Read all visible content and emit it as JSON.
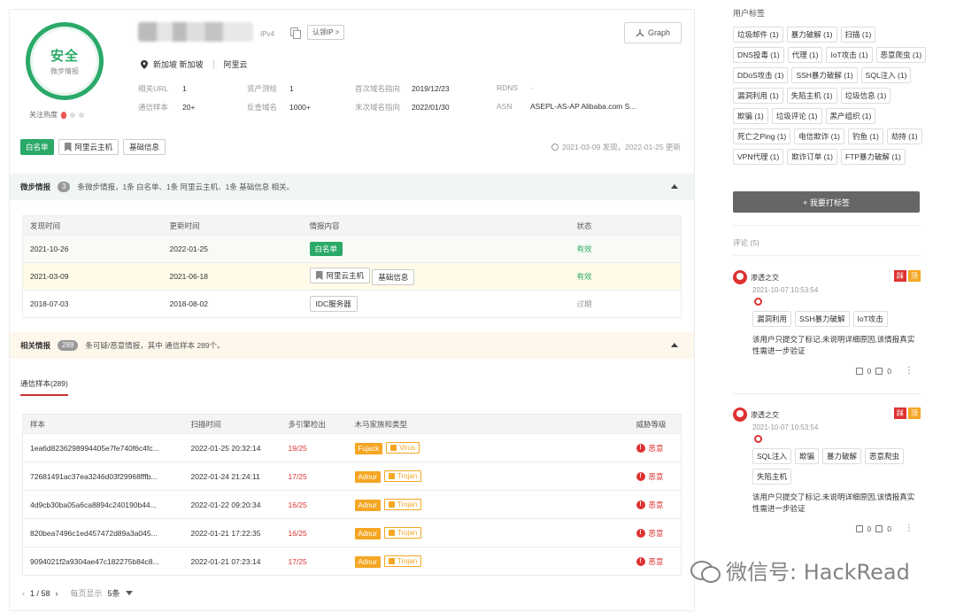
{
  "header": {
    "verdict": "安全",
    "verdict_source": "微步情报",
    "ip_type": "IPv4",
    "claim_label": "认领IP >",
    "graph_label": "Graph",
    "heat_label": "关注热度",
    "location": "新加坡 新加坡",
    "isp": "阿里云",
    "related_url_label": "相关URL",
    "related_url": "1",
    "asset_label": "资产测绘",
    "asset": "1",
    "first_domain_label": "首次域名指向",
    "first_domain": "2019/12/23",
    "rdns_label": "RDNS",
    "rdns": "-",
    "comm_label": "通信样本",
    "comm": "20+",
    "reverse_label": "反查域名",
    "reverse": "1000+",
    "last_domain_label": "末次域名指向",
    "last_domain": "2022/01/30",
    "asn_label": "ASN",
    "asn": "ASEPL-AS-AP Alibaba.com S..."
  },
  "tags": {
    "whitelist": "白名单",
    "aliyun_host": "阿里云主机",
    "basic_info": "基础信息",
    "discovered": "2021-03-09 发现，2022-01-25 更新"
  },
  "intel": {
    "title": "微步情报",
    "count": "3",
    "desc": "条微步情报，1条 白名单、1条 阿里云主机、1条 基础信息 相关。",
    "columns": [
      "发现时间",
      "更新时间",
      "情报内容",
      "状态"
    ],
    "rows": [
      {
        "found": "2021-10-26",
        "updated": "2022-01-25",
        "content": "白名单",
        "status": "有效"
      },
      {
        "found": "2021-03-09",
        "updated": "2021-06-18",
        "content": "阿里云主机",
        "content2": "基础信息",
        "status": "有效"
      },
      {
        "found": "2018-07-03",
        "updated": "2018-08-02",
        "content": "IDC服务器",
        "status": "过期"
      }
    ]
  },
  "related": {
    "title": "相关情报",
    "count": "289",
    "desc": "条可疑/恶意情报，其中 通信样本 289个。",
    "tab": "通信样本(289)",
    "columns": [
      "样本",
      "扫描时间",
      "多引擎检出",
      "木马家族和类型",
      "威胁等级"
    ],
    "rows": [
      {
        "hash": "1ea6d8236298994405e7fe740f6c4fc...",
        "time": "2022-01-25 20:32:14",
        "detect": "19/25",
        "family": "Fujack",
        "type": "Virus",
        "level": "恶意"
      },
      {
        "hash": "72681491ac37ea3246d03f29968fffb...",
        "time": "2022-01-24 21:24:11",
        "detect": "17/25",
        "family": "Adnur",
        "type": "Trojan",
        "level": "恶意"
      },
      {
        "hash": "4d9cb30ba05a6ca8894c240190b44...",
        "time": "2022-01-22 09:20:34",
        "detect": "16/25",
        "family": "Adnur",
        "type": "Trojan",
        "level": "恶意"
      },
      {
        "hash": "820bea7496c1ed457472d89a3a045...",
        "time": "2022-01-21 17:22:35",
        "detect": "16/25",
        "family": "Adnur",
        "type": "Trojan",
        "level": "恶意"
      },
      {
        "hash": "9094021f2a9304ae47c182275b84c8...",
        "time": "2022-01-21 07:23:14",
        "detect": "17/25",
        "family": "Adnur",
        "type": "Trojan",
        "level": "恶意"
      }
    ],
    "pager": {
      "page": "1 / 58",
      "per_page_label": "每页显示",
      "per_page": "5条"
    }
  },
  "sidebar": {
    "title": "用户标签",
    "tags": [
      "垃圾邮件 (1)",
      "暴力破解 (1)",
      "扫描 (1)",
      "DNS投毒 (1)",
      "代理 (1)",
      "IoT攻击 (1)",
      "恶意爬虫 (1)",
      "DDoS攻击 (1)",
      "SSH暴力破解 (1)",
      "SQL注入 (1)",
      "漏洞利用 (1)",
      "失陷主机 (1)",
      "垃圾信息 (1)",
      "欺骗 (1)",
      "垃圾评论 (1)",
      "黑产组织 (1)",
      "死亡之Ping (1)",
      "电信欺诈 (1)",
      "钓鱼 (1)",
      "劫持 (1)",
      "VPN代理 (1)",
      "欺诈订单 (1)",
      "FTP暴力破解 (1)"
    ],
    "add_tag": "+ 我要打标签",
    "comments_label": "评论 (5)",
    "comments": [
      {
        "user": "渗透之交",
        "time": "2021-10-07 10:53:54",
        "tags": [
          "漏洞利用",
          "SSH暴力破解",
          "IoT攻击"
        ],
        "text": "该用户只提交了标记,未说明详细原因,该情报真实性需进一步验证",
        "up": "0",
        "down": "0",
        "act1": "踩",
        "act2": "顶"
      },
      {
        "user": "渗透之交",
        "time": "2021-10-07 10:53:54",
        "tags": [
          "SQL注入",
          "欺骗",
          "暴力破解",
          "恶意爬虫",
          "失陷主机"
        ],
        "text": "该用户只提交了标记,未说明详细原因,该情报真实性需进一步验证",
        "up": "0",
        "down": "0",
        "act1": "踩",
        "act2": "顶"
      }
    ]
  },
  "watermark": "微信号: HackRead",
  "colors": {
    "safe": "#2aa968",
    "malicious": "#d33333",
    "family": "#f5a623"
  }
}
